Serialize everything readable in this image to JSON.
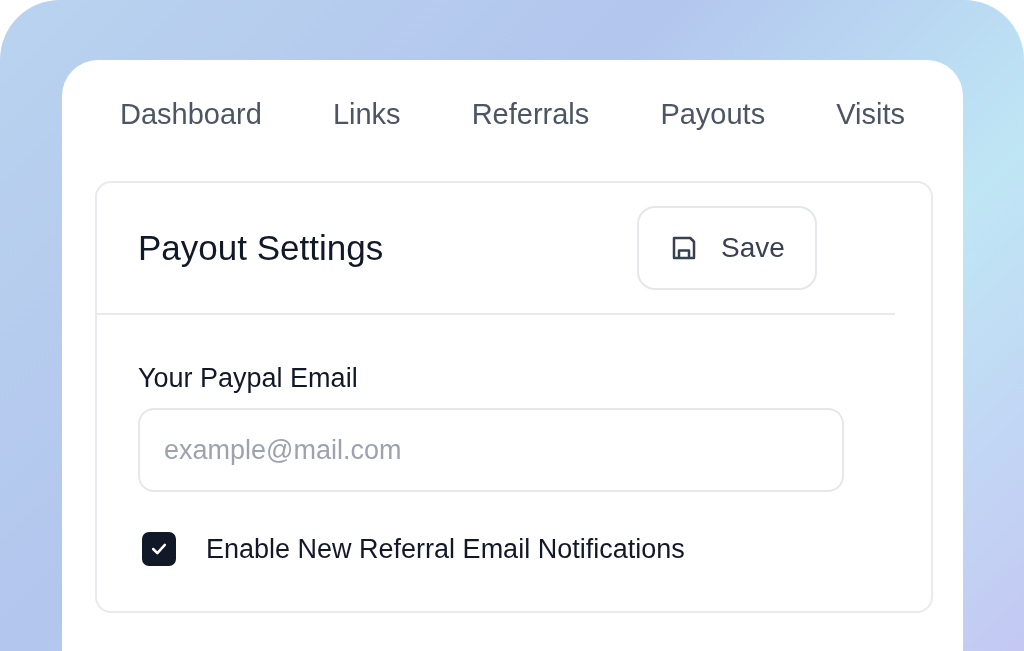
{
  "tabs": [
    {
      "label": "Dashboard",
      "selected": false
    },
    {
      "label": "Links",
      "selected": false
    },
    {
      "label": "Referrals",
      "selected": false
    },
    {
      "label": "Payouts",
      "selected": false
    },
    {
      "label": "Visits",
      "selected": false
    }
  ],
  "panel": {
    "title": "Payout Settings",
    "save_button": "Save",
    "email_field": {
      "label": "Your Paypal Email",
      "placeholder": "example@mail.com"
    },
    "notifications": {
      "label": "Enable New Referral Email Notifications",
      "checked": true
    }
  }
}
